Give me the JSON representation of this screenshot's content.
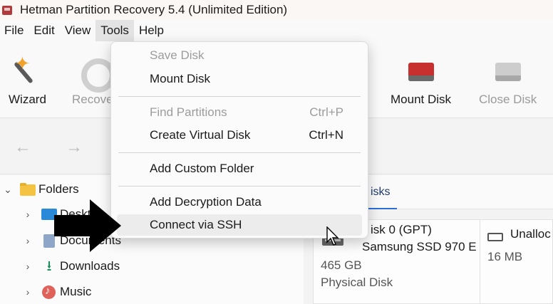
{
  "window": {
    "title": "Hetman Partition Recovery 5.4 (Unlimited Edition)"
  },
  "menubar": {
    "items": [
      "File",
      "Edit",
      "View",
      "Tools",
      "Help"
    ],
    "active": "Tools"
  },
  "toolbar": {
    "wizard": "Wizard",
    "recovery": "Recove",
    "mount_disk": "Mount Disk",
    "close_disk": "Close Disk"
  },
  "nav": {
    "back": "←",
    "forward": "→"
  },
  "tree": {
    "root": "Folders",
    "items": [
      "Desktop",
      "Documents",
      "Downloads",
      "Music"
    ]
  },
  "disks_panel": {
    "tab": "isks",
    "disk0_name": "isk 0 (GPT)",
    "disk0_model": "Samsung SSD 970 E",
    "disk0_size": "465 GB",
    "disk0_type": "Physical Disk",
    "unalloc_label": "Unalloc",
    "unalloc_size": "16 MB"
  },
  "tools_menu": {
    "save_disk": "Save Disk",
    "mount_disk": "Mount Disk",
    "find_partitions": "Find Partitions",
    "find_partitions_shortcut": "Ctrl+P",
    "create_virtual_disk": "Create Virtual Disk",
    "create_virtual_disk_shortcut": "Ctrl+N",
    "add_custom_folder": "Add Custom Folder",
    "add_decryption_data": "Add Decryption Data",
    "connect_ssh": "Connect via SSH"
  }
}
